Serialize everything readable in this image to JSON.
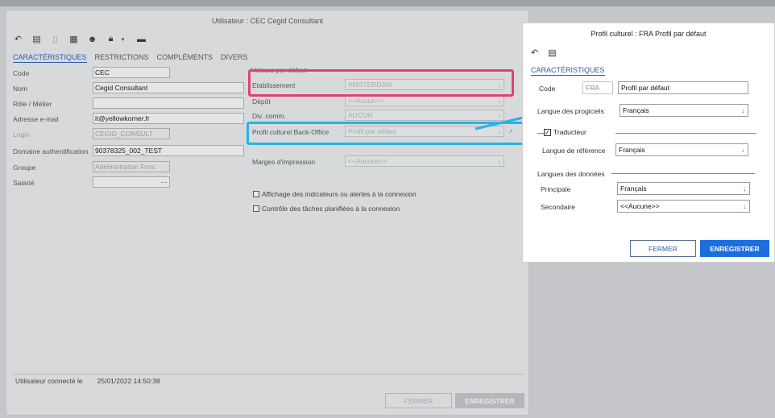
{
  "main": {
    "title": "Utilisateur : CEC Cegid Consultant",
    "tabs": [
      "CARACTÉRISTIQUES",
      "RESTRICTIONS",
      "COMPLÉMENTS",
      "DIVERS"
    ],
    "fields": {
      "code_label": "Code",
      "code_value": "CEC",
      "nom_label": "Nom",
      "nom_value": "Cegid Consultant",
      "role_label": "Rôle / Métier",
      "role_value": "",
      "email_label": "Adresse e-mail",
      "email_value": "it@yellowkorner.fr",
      "login_label": "Login",
      "login_value": "CEGID_CONSULT",
      "domaine_label": "Domaine authentification",
      "domaine_value": "90378325_002_TEST",
      "groupe_label": "Groupe",
      "groupe_value": "Administration Fonc",
      "salarie_label": "Salarié",
      "salarie_value": "···"
    },
    "right": {
      "section_label": "Valeurs par défaut",
      "etab_label": "Etablissement",
      "etab_value": "AMSTERDAM",
      "depot_label": "Dépôt",
      "depot_value": "<<Aucun>>",
      "div_label": "Div. comm.",
      "div_value": "AUCUN",
      "profil_label": "Profil culturel Back-Office",
      "profil_value": "Profil par défaut",
      "marges_label": "Marges d'impression",
      "marges_value": "<<Aucune>>",
      "chk1": "Affichage des indicateurs ou alertes à la connexion",
      "chk2": "Contrôle des tâches planifiées à la connexion"
    },
    "footer": {
      "label": "Utilisateur connecté le",
      "value": "25/01/2022 14:50:38"
    },
    "buttons": {
      "close": "FERMER",
      "save": "ENREGISTRER"
    }
  },
  "dialog": {
    "title": "Profil culturel : FRA Profil par défaut",
    "tab": "CARACTÉRISTIQUES",
    "code_label": "Code",
    "code_value": "FRA",
    "name_value": "Profil par défaut",
    "langue_progiciels_label": "Langue des progiciels",
    "langue_progiciels_value": "Français",
    "traducteur_label": "Traducteur",
    "langue_ref_label": "Langue de référence",
    "langue_ref_value": "Français",
    "donnees_label": "Langues des données",
    "principale_label": "Principale",
    "principale_value": "Français",
    "secondaire_label": "Secondaire",
    "secondaire_value": "<<Aucune>>",
    "close": "FERMER",
    "save": "ENREGISTRER"
  },
  "icons": {
    "undo": "undo-icon",
    "new": "new-record-icon",
    "delete": "trash-icon",
    "list": "list-icon",
    "users": "users-icon",
    "lock": "lock-icon",
    "print": "print-icon"
  },
  "colors": {
    "accent": "#1a6ee0",
    "highlight_red": "#e0417b",
    "highlight_blue": "#23b5e8"
  }
}
